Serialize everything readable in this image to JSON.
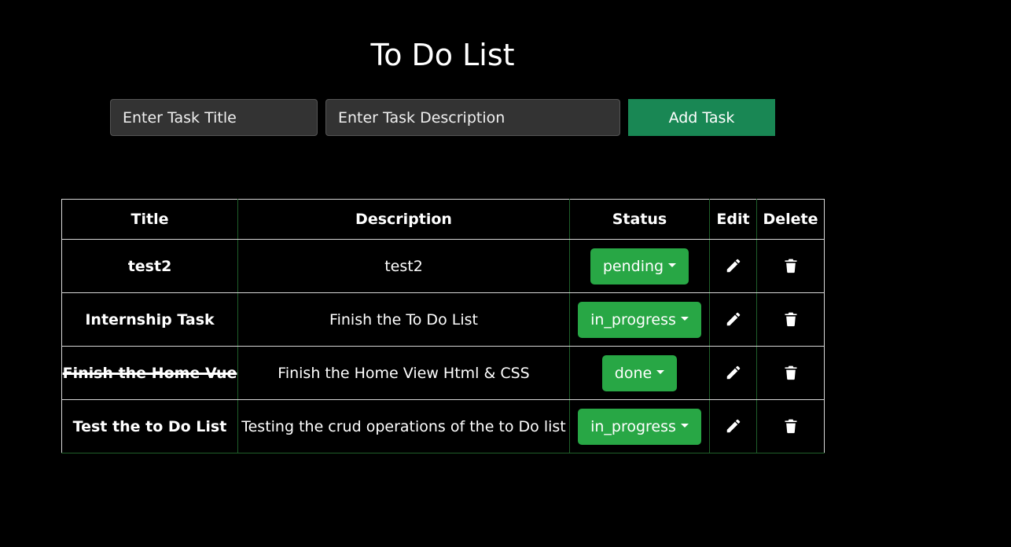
{
  "header": {
    "title": "To Do List"
  },
  "form": {
    "title_placeholder": "Enter Task Title",
    "description_placeholder": "Enter Task Description",
    "add_label": "Add Task"
  },
  "table": {
    "headers": [
      "Title",
      "Description",
      "Status",
      "Edit",
      "Delete"
    ],
    "rows": [
      {
        "title": "test2",
        "description": "test2",
        "status": "pending",
        "done": false
      },
      {
        "title": "Internship Task",
        "description": "Finish the To Do List",
        "status": "in_progress",
        "done": false
      },
      {
        "title": "Finish the Home Vue",
        "description": "Finish the Home View Html & CSS",
        "status": "done",
        "done": true
      },
      {
        "title": "Test the to Do List",
        "description": "Testing the crud operations of the to Do list",
        "status": "in_progress",
        "done": false
      }
    ]
  },
  "icons": {
    "edit": "pencil-icon",
    "delete": "trash-icon",
    "status_toggle": "caret-down-icon"
  },
  "colors": {
    "background": "#000000",
    "input_background": "#333333",
    "add_button": "#198754",
    "status_button": "#28a745",
    "text": "#ffffff"
  }
}
